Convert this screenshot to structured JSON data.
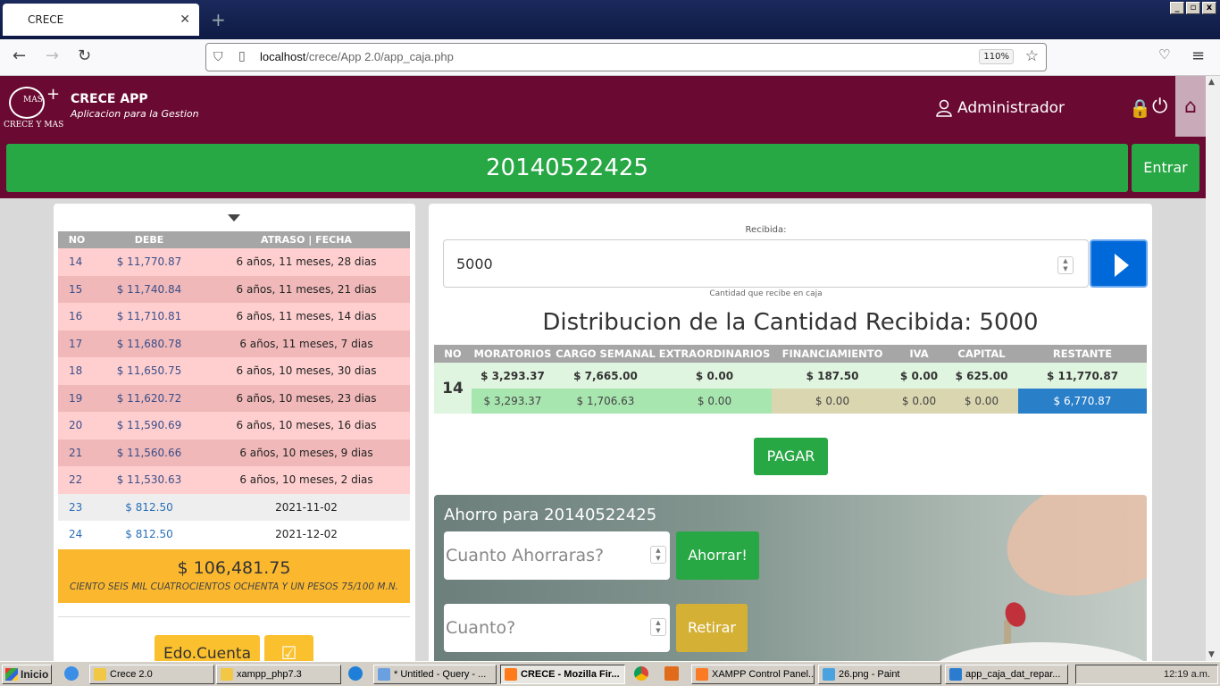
{
  "browser": {
    "tab_title": "CRECE",
    "url_host": "localhost",
    "url_path": "/crece/App 2.0/app_caja.php",
    "zoom": "110%"
  },
  "app": {
    "logo_sub": "CRECE Y MAS",
    "logo_mark": "MAS",
    "title": "CRECE APP",
    "subtitle": "Aplicacion para la Gestion",
    "user": "Administrador",
    "account_number": "20140522425",
    "enter_label": "Entrar"
  },
  "left": {
    "headers": [
      "NO",
      "DEBE",
      "ATRASO | FECHA"
    ],
    "rows": [
      {
        "no": "14",
        "debe": "$ 11,770.87",
        "info": "6 años, 11 meses, 28 dias",
        "late": true
      },
      {
        "no": "15",
        "debe": "$ 11,740.84",
        "info": "6 años, 11 meses, 21 dias",
        "late": true
      },
      {
        "no": "16",
        "debe": "$ 11,710.81",
        "info": "6 años, 11 meses, 14 dias",
        "late": true
      },
      {
        "no": "17",
        "debe": "$ 11,680.78",
        "info": "6 años, 11 meses, 7 dias",
        "late": true
      },
      {
        "no": "18",
        "debe": "$ 11,650.75",
        "info": "6 años, 10 meses, 30 dias",
        "late": true
      },
      {
        "no": "19",
        "debe": "$ 11,620.72",
        "info": "6 años, 10 meses, 23 dias",
        "late": true
      },
      {
        "no": "20",
        "debe": "$ 11,590.69",
        "info": "6 años, 10 meses, 16 dias",
        "late": true
      },
      {
        "no": "21",
        "debe": "$ 11,560.66",
        "info": "6 años, 10 meses, 9 dias",
        "late": true
      },
      {
        "no": "22",
        "debe": "$ 11,530.63",
        "info": "6 años, 10 meses, 2 dias",
        "late": true
      },
      {
        "no": "23",
        "debe": "$ 812.50",
        "info": "2021-11-02",
        "late": false
      },
      {
        "no": "24",
        "debe": "$ 812.50",
        "info": "2021-12-02",
        "late": false
      }
    ],
    "total_amount": "$ 106,481.75",
    "total_words": "CIENTO SEIS MIL CUATROCIENTOS OCHENTA Y UN PESOS 75/100 M.N.",
    "edo_label": "Edo.Cuenta"
  },
  "right": {
    "received_label": "Recibida:",
    "received_value": "5000",
    "received_hint": "Cantidad que recibe en caja",
    "dist_title": "Distribucion de la Cantidad Recibida: 5000",
    "headers": [
      "NO",
      "MORATORIOS",
      "CARGO SEMANAL",
      "EXTRAORDINARIOS",
      "FINANCIAMIENTO",
      "IVA",
      "CAPITAL",
      "RESTANTE"
    ],
    "no": "14",
    "row_due": [
      "$ 3,293.37",
      "$ 7,665.00",
      "$ 0.00",
      "$ 187.50",
      "$ 0.00",
      "$ 625.00",
      "$ 11,770.87"
    ],
    "row_paid": [
      "$ 3,293.37",
      "$ 1,706.63",
      "$ 0.00",
      "$ 0.00",
      "$ 0.00",
      "$ 0.00",
      "$ 6,770.87"
    ],
    "pay_label": "PAGAR",
    "savings_title": "Ahorro para 20140522425",
    "save_placeholder": "Cuanto Ahorraras?",
    "save_label": "Ahorrar!",
    "withdraw_placeholder": "Cuanto?",
    "withdraw_label": "Retirar"
  },
  "taskbar": {
    "start": "Inicio",
    "items": [
      {
        "label": "Crece 2.0",
        "color": "#f2c744"
      },
      {
        "label": "xampp_php7.3",
        "color": "#f2c744"
      },
      {
        "label": "* Untitled - Query - ...",
        "color": "#6aa0e0"
      },
      {
        "label": "CRECE - Mozilla Fir...",
        "color": "#ff7a1a"
      },
      {
        "label": "XAMPP Control Panel...",
        "color": "#fb7a24"
      },
      {
        "label": "26.png - Paint",
        "color": "#4aa3df"
      },
      {
        "label": "app_caja_dat_repar...",
        "color": "#2b7bd0"
      }
    ],
    "clock": "12:19 a.m."
  }
}
